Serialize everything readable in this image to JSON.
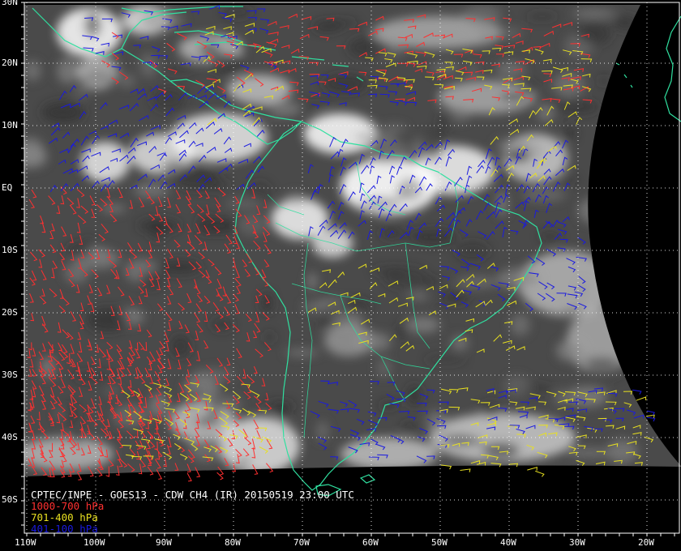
{
  "title": "CPTEC/INPE - GOES13 - CDW CH4 (IR) 20150519 23:00 UTC",
  "legend": [
    {
      "label": "1000-700 hPa",
      "color": "#ff3030"
    },
    {
      "label": "701-400 hPa",
      "color": "#e8e020"
    },
    {
      "label": "401-100 hPa",
      "color": "#1a1ae0"
    }
  ],
  "colors": {
    "background": "#000000",
    "ir_cloud_base": "#4a4a4a",
    "coastline": "#30e0a0",
    "frame": "#ffffff",
    "grid": "#ffffff"
  },
  "lat_labels": [
    "30N",
    "20N",
    "10N",
    "EQ",
    "10S",
    "20S",
    "30S",
    "40S",
    "50S"
  ],
  "lon_labels": [
    "110W",
    "100W",
    "90W",
    "80W",
    "70W",
    "60W",
    "50W",
    "40W",
    "30W",
    "20W"
  ],
  "map_extent": {
    "lon_min": -110,
    "lon_max": -15,
    "lat_min": -55,
    "lat_max": 30
  }
}
